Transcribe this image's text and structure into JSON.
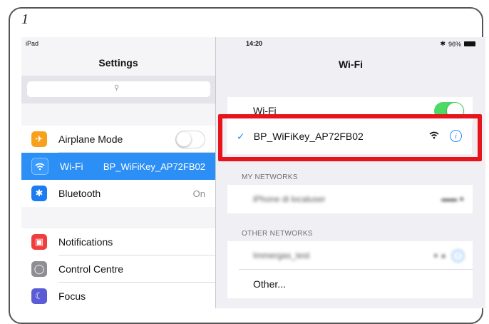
{
  "step_number": "1",
  "status_bar": {
    "device": "iPad",
    "time": "14:20",
    "battery": "96%"
  },
  "settings": {
    "title": "Settings",
    "search_placeholder": "",
    "group1": [
      {
        "label": "Airplane Mode",
        "value": "",
        "icon": "airplane-icon",
        "color": "#f7a01c"
      },
      {
        "label": "Wi-Fi",
        "value": "BP_WiFiKey_AP72FB02",
        "icon": "wifi-icon",
        "color": "#2c8ff5"
      },
      {
        "label": "Bluetooth",
        "value": "On",
        "icon": "bluetooth-icon",
        "color": "#1d7cf2"
      }
    ],
    "group2": [
      {
        "label": "Notifications",
        "icon": "notifications-icon",
        "color": "#f13d3d"
      },
      {
        "label": "Control Centre",
        "icon": "control-centre-icon",
        "color": "#8e8e93"
      },
      {
        "label": "Focus",
        "icon": "moon-icon",
        "color": "#5b5bd6"
      }
    ]
  },
  "wifi": {
    "title": "Wi-Fi",
    "toggle_label": "Wi-Fi",
    "toggle_on": true,
    "connected_network": "BP_WiFiKey_AP72FB02",
    "my_networks_header": "MY NETWORKS",
    "my_networks": [
      {
        "name": "iPhone di localuser"
      }
    ],
    "other_networks_header": "OTHER NETWORKS",
    "other_networks": [
      {
        "name": "Immergas_test"
      }
    ],
    "other_label": "Other..."
  },
  "colors": {
    "accent": "#2c8ff5",
    "highlight": "#e8141b",
    "toggle_on": "#4cd964"
  }
}
